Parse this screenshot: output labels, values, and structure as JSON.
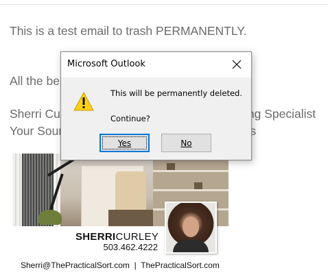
{
  "email": {
    "body_line": "This is a test email to trash PERMANENTLY.",
    "closing_line": "All the best,",
    "name_line": "Sherri Curley, Certified Professional Organizing Specialist",
    "tagline_line": "Your Source for Practical Organizing Solutions"
  },
  "signature": {
    "name_first": "SHERRI",
    "name_last": "CURLEY",
    "phone": "503.462.4222",
    "contact": "Sherri@ThePracticalSort.com  |  ThePracticalSort.com"
  },
  "dialog": {
    "title": "Microsoft Outlook",
    "message": "This will be permanently deleted.",
    "question": "Continue?",
    "yes_label": "Yes",
    "no_label": "No",
    "icon": "warning-icon",
    "close_icon": "close-icon"
  },
  "colors": {
    "focus_border": "#0078d7",
    "warning_yellow": "#fcd116",
    "text_gray": "#6b6b6b"
  }
}
